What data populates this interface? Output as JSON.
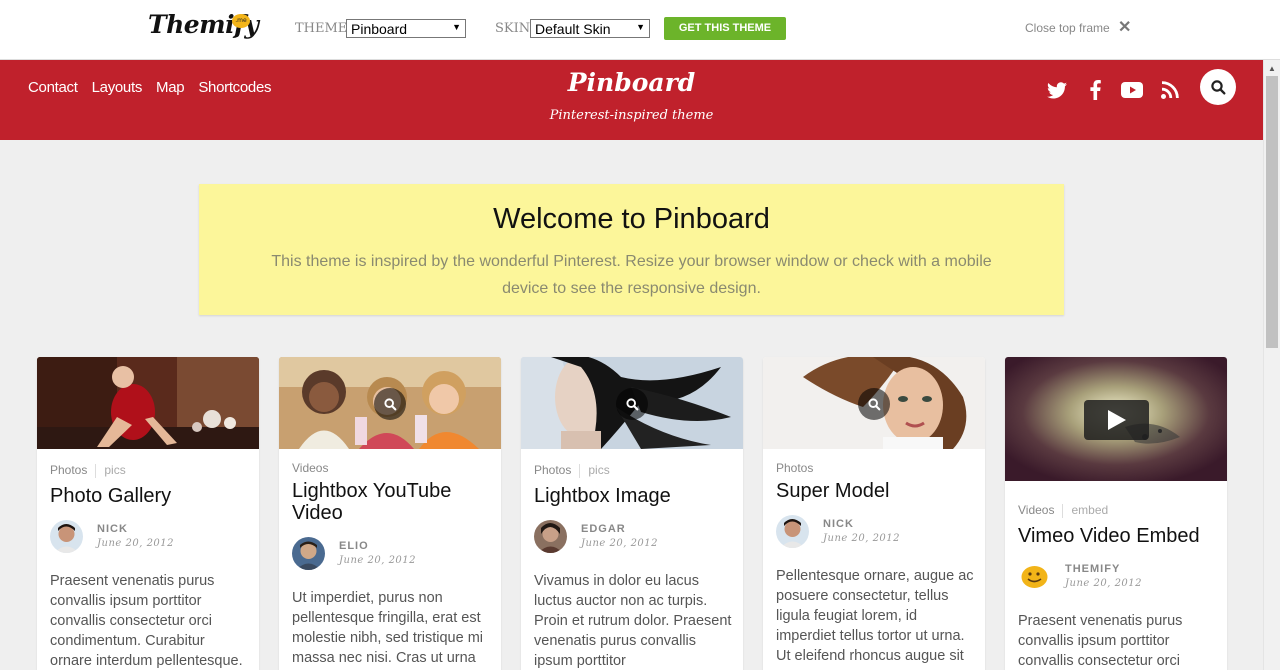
{
  "topframe": {
    "logo": "Themify",
    "logo_badge": ".me",
    "theme_label": "THEME",
    "theme_value": "Pinboard",
    "skin_label": "SKIN",
    "skin_value": "Default Skin",
    "get_theme": "GET THIS THEME",
    "close_label": "Close top frame"
  },
  "header": {
    "nav": [
      "Contact",
      "Layouts",
      "Map",
      "Shortcodes"
    ],
    "brand": "Pinboard",
    "tagline": "Pinterest-inspired theme",
    "social": [
      "twitter-icon",
      "facebook-icon",
      "youtube-icon",
      "rss-icon"
    ],
    "accent": "#c0212c"
  },
  "welcome": {
    "title": "Welcome to Pinboard",
    "text": "This theme is inspired by the wonderful Pinterest. Resize your browser window or check with a mobile device to see the responsive design."
  },
  "posts": [
    {
      "cat1": "Photos",
      "cat2": "pics",
      "title": "Photo Gallery",
      "author": "NICK",
      "date": "June 20, 2012",
      "excerpt": "Praesent venenatis purus convallis ipsum porttitor convallis consectetur orci condimentum. Curabitur ornare interdum pellentesque."
    },
    {
      "cat1": "Videos",
      "cat2": "",
      "title": "Lightbox YouTube Video",
      "author": "ELIO",
      "date": "June 20, 2012",
      "excerpt": "Ut imperdiet, purus non pellentesque fringilla, erat est molestie nibh, sed tristique mi massa nec nisi. Cras ut urna"
    },
    {
      "cat1": "Photos",
      "cat2": "pics",
      "title": "Lightbox Image",
      "author": "EDGAR",
      "date": "June 20, 2012",
      "excerpt": "Vivamus in dolor eu lacus luctus auctor non ac turpis. Proin et rutrum dolor. Praesent venenatis purus convallis ipsum porttitor"
    },
    {
      "cat1": "Photos",
      "cat2": "",
      "title": "Super Model",
      "author": "NICK",
      "date": "June 20, 2012",
      "excerpt": "Pellentesque ornare, augue ac posuere consectetur, tellus ligula feugiat lorem, id imperdiet tellus tortor ut urna. Ut eleifend rhoncus augue sit"
    },
    {
      "cat1": "Videos",
      "cat2": "embed",
      "title": "Vimeo Video Embed",
      "author": "THEMIFY",
      "date": "June 20, 2012",
      "excerpt": "Praesent venenatis purus convallis ipsum porttitor convallis consectetur orci"
    }
  ]
}
